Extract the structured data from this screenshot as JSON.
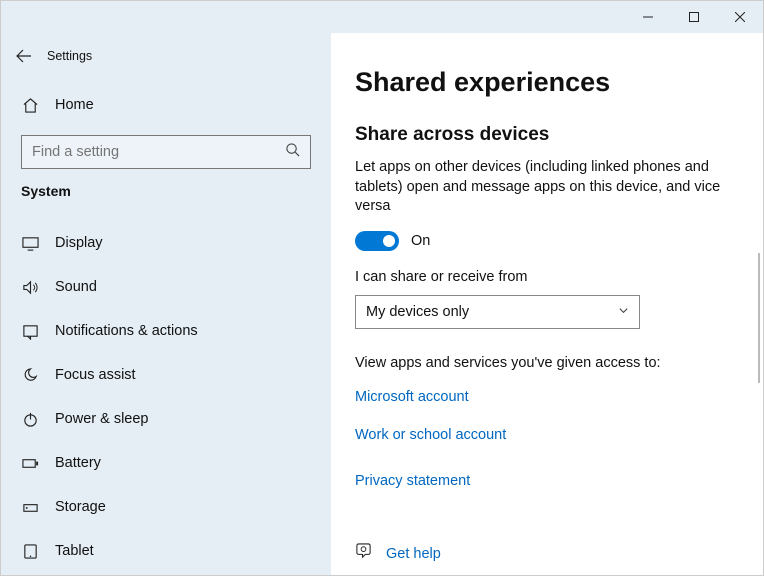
{
  "window": {
    "app_title": "Settings"
  },
  "sidebar": {
    "home": "Home",
    "search_placeholder": "Find a setting",
    "category": "System",
    "items": [
      {
        "label": "Display"
      },
      {
        "label": "Sound"
      },
      {
        "label": "Notifications & actions"
      },
      {
        "label": "Focus assist"
      },
      {
        "label": "Power & sleep"
      },
      {
        "label": "Battery"
      },
      {
        "label": "Storage"
      },
      {
        "label": "Tablet"
      }
    ]
  },
  "main": {
    "page_title": "Shared experiences",
    "section_title": "Share across devices",
    "description": "Let apps on other devices (including linked phones and tablets) open and message apps on this device, and vice versa",
    "toggle_state": "On",
    "share_from_label": "I can share or receive from",
    "share_from_value": "My devices only",
    "view_apps_label": "View apps and services you've given access to:",
    "links": {
      "ms_account": "Microsoft account",
      "work_account": "Work or school account",
      "privacy": "Privacy statement"
    },
    "get_help": "Get help"
  }
}
